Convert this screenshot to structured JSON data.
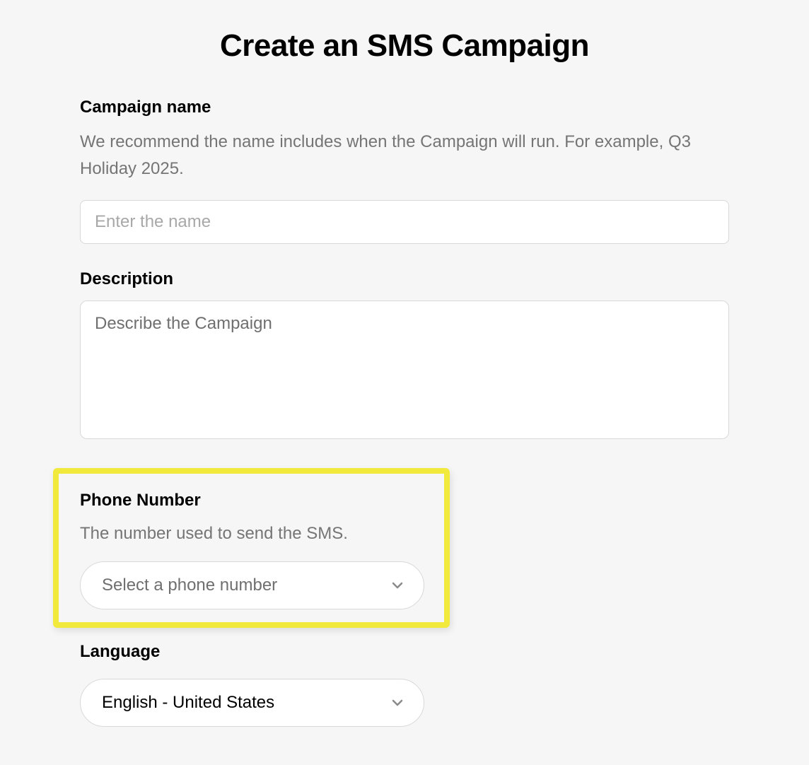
{
  "title": "Create an SMS Campaign",
  "campaign_name": {
    "label": "Campaign name",
    "help": "We recommend the name includes when the Campaign will run. For example, Q3 Holiday 2025.",
    "placeholder": "Enter the name",
    "value": ""
  },
  "description": {
    "label": "Description",
    "placeholder": "Describe the Campaign",
    "value": ""
  },
  "phone_number": {
    "label": "Phone Number",
    "help": "The number used to send the SMS.",
    "placeholder": "Select a phone number",
    "value": ""
  },
  "language": {
    "label": "Language",
    "value": "English - United States"
  }
}
